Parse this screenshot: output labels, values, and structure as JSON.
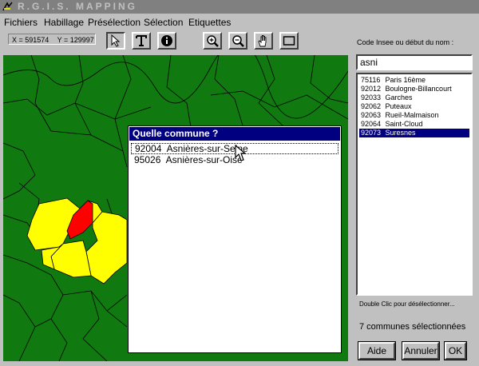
{
  "app": {
    "title": "R.G.I.S.  MAPPING"
  },
  "menu": [
    "Fichiers",
    "Habillage",
    "Présélection",
    "Sélection",
    "Etiquettes"
  ],
  "coords": {
    "x": "X = 591574",
    "y": "Y = 129997"
  },
  "toolbar": [
    {
      "name": "pointer-tool",
      "icon": "arrow-pointer"
    },
    {
      "name": "text-tool",
      "icon": "letter-t"
    },
    {
      "name": "info-tool",
      "icon": "info"
    },
    {
      "name": "zoom-in-tool",
      "icon": "magnifier-plus"
    },
    {
      "name": "zoom-out-tool",
      "icon": "magnifier-minus"
    },
    {
      "name": "pan-tool",
      "icon": "hand"
    },
    {
      "name": "frame-tool",
      "icon": "rectangle"
    }
  ],
  "dialog": {
    "title": "Quelle commune ?",
    "items": [
      {
        "code": "92004",
        "name": "Asnières-sur-Seine"
      },
      {
        "code": "95026",
        "name": "Asnières-sur-Oise"
      }
    ]
  },
  "side": {
    "label": "Code Insee ou début du nom :",
    "search_value": "asni",
    "list": [
      {
        "code": "75116",
        "name": "Paris 16ème"
      },
      {
        "code": "92012",
        "name": "Boulogne-Billancourt"
      },
      {
        "code": "92033",
        "name": "Garches"
      },
      {
        "code": "92062",
        "name": "Puteaux"
      },
      {
        "code": "92063",
        "name": "Rueil-Malmaison"
      },
      {
        "code": "92064",
        "name": "Saint-Cloud"
      },
      {
        "code": "92073",
        "name": "Suresnes"
      }
    ],
    "hint": "Double Clic pour désélectionner...",
    "count": "7 communes sélectionnées"
  },
  "buttons": {
    "help": "Aide",
    "cancel": "Annuler",
    "ok": "OK"
  },
  "colors": {
    "map_green": "#107a10",
    "selected_yellow": "#ffff00",
    "highlight_red": "#ff0000",
    "title_navy": "#000080"
  }
}
